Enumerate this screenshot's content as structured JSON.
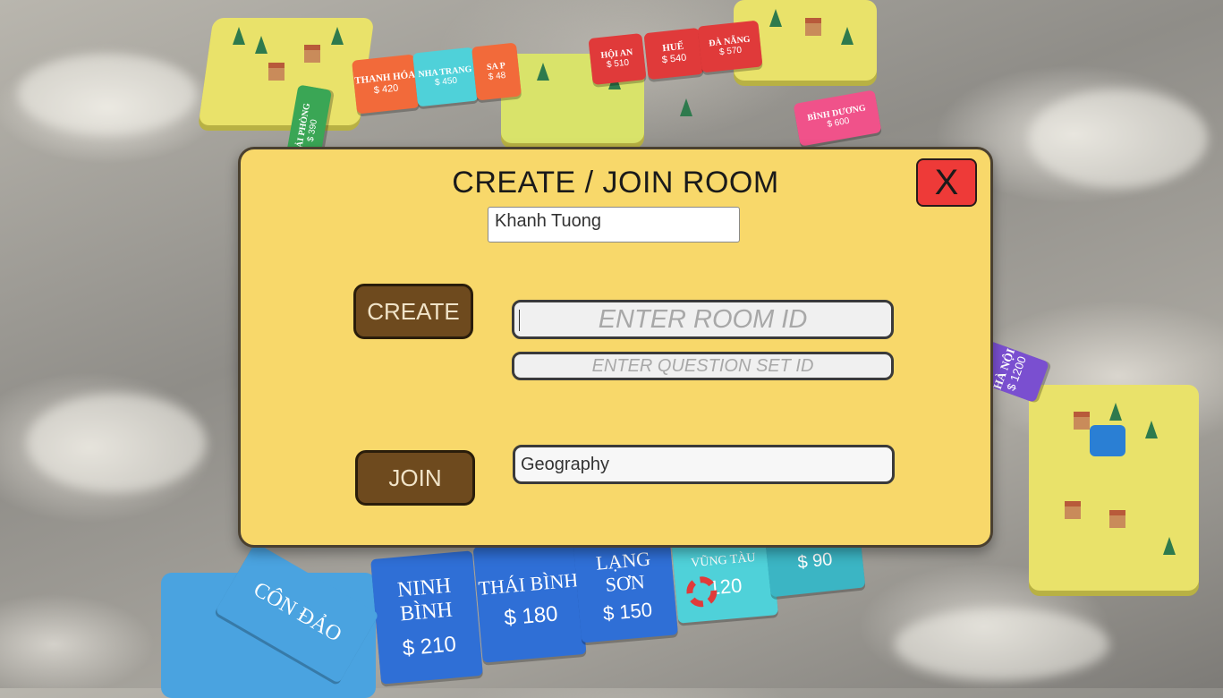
{
  "dialog": {
    "title": "CREATE / JOIN ROOM",
    "close_label": "X",
    "player_name": "Khanh Tuong",
    "create_label": "CREATE",
    "join_label": "JOIN",
    "room_id_placeholder": "ENTER ROOM ID",
    "question_set_placeholder": "ENTER QUESTION SET ID",
    "subject_value": "Geography"
  },
  "colors": {
    "dialog_bg": "#f8d86a",
    "button_brown": "#6e4a1e",
    "close_red": "#ee3a38"
  },
  "board_tiles": [
    {
      "name": "THANH HÓA",
      "price": "$ 420",
      "color": "#f26a3a"
    },
    {
      "name": "NHA TRANG",
      "price": "$ 450",
      "color": "#4fd1d9"
    },
    {
      "name": "SA P",
      "price": "$ 48",
      "color": "#f26a3a"
    },
    {
      "name": "HỘI AN",
      "price": "$ 510",
      "color": "#e03a3a"
    },
    {
      "name": "HUẾ",
      "price": "$ 540",
      "color": "#e03a3a"
    },
    {
      "name": "ĐÀ NẴNG",
      "price": "$ 570",
      "color": "#e03a3a"
    },
    {
      "name": "HẢI PHÒNG",
      "price": "$ 390",
      "color": "#3aa655"
    },
    {
      "name": "BÌNH DƯƠNG",
      "price": "$ 600",
      "color": "#f0528a"
    },
    {
      "name": "HÀ NỘI",
      "price": "$ 1200",
      "color": "#7a4fd0"
    },
    {
      "name": "NINH BÌNH",
      "price": "$ 210",
      "color": "#2f6fd6"
    },
    {
      "name": "THÁI BÌNH",
      "price": "$ 180",
      "color": "#2f6fd6"
    },
    {
      "name": "LẠNG SƠN",
      "price": "$ 150",
      "color": "#2f6fd6"
    },
    {
      "name": "VŨNG TÀU",
      "price": "120",
      "color": "#4fd1d9"
    },
    {
      "name": "",
      "price": "$ 90",
      "color": "#3bb5c4"
    },
    {
      "name": "CÔN ĐẢO",
      "price": "",
      "color": "#4aa3e0"
    }
  ]
}
